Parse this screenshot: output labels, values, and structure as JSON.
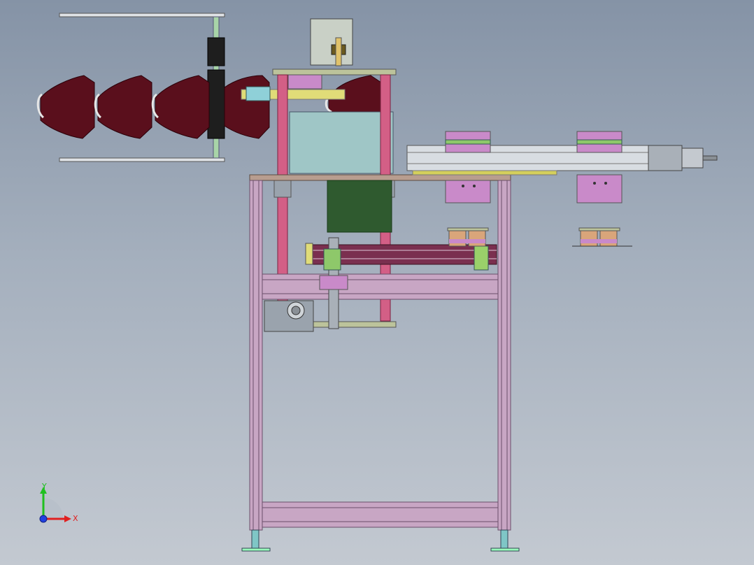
{
  "viewport": {
    "background_top": "#8593a6",
    "background_bottom": "#c3c9d1"
  },
  "colors": {
    "frame_profile": "#c8a6c4",
    "frame_edge": "#6a4f6a",
    "guide_pillar": "#d35f86",
    "bushing": "#9aa3ad",
    "plate": "#bcc39b",
    "box_cyan": "#9fc6c6",
    "box_dark_green": "#2f5a2f",
    "motor_housing": "#c9d0c6",
    "mask": "#5a0f1c",
    "mask_strap": "#e6e6e6",
    "yellow_clamp": "#e0dc78",
    "linear_module": "#d8dde2",
    "carriage_magenta": "#c98ac9",
    "carriage_green": "#8ec86a",
    "belt": "#7a2f4f",
    "small_green_block": "#9ad06a",
    "foot": "#7fc6c6"
  },
  "orientation_triad": {
    "icon": "axis-triad-icon",
    "x_label": "X",
    "y_label": "Y",
    "x_color": "#e02020",
    "y_color": "#20c020",
    "z_color": "#2040e0"
  }
}
